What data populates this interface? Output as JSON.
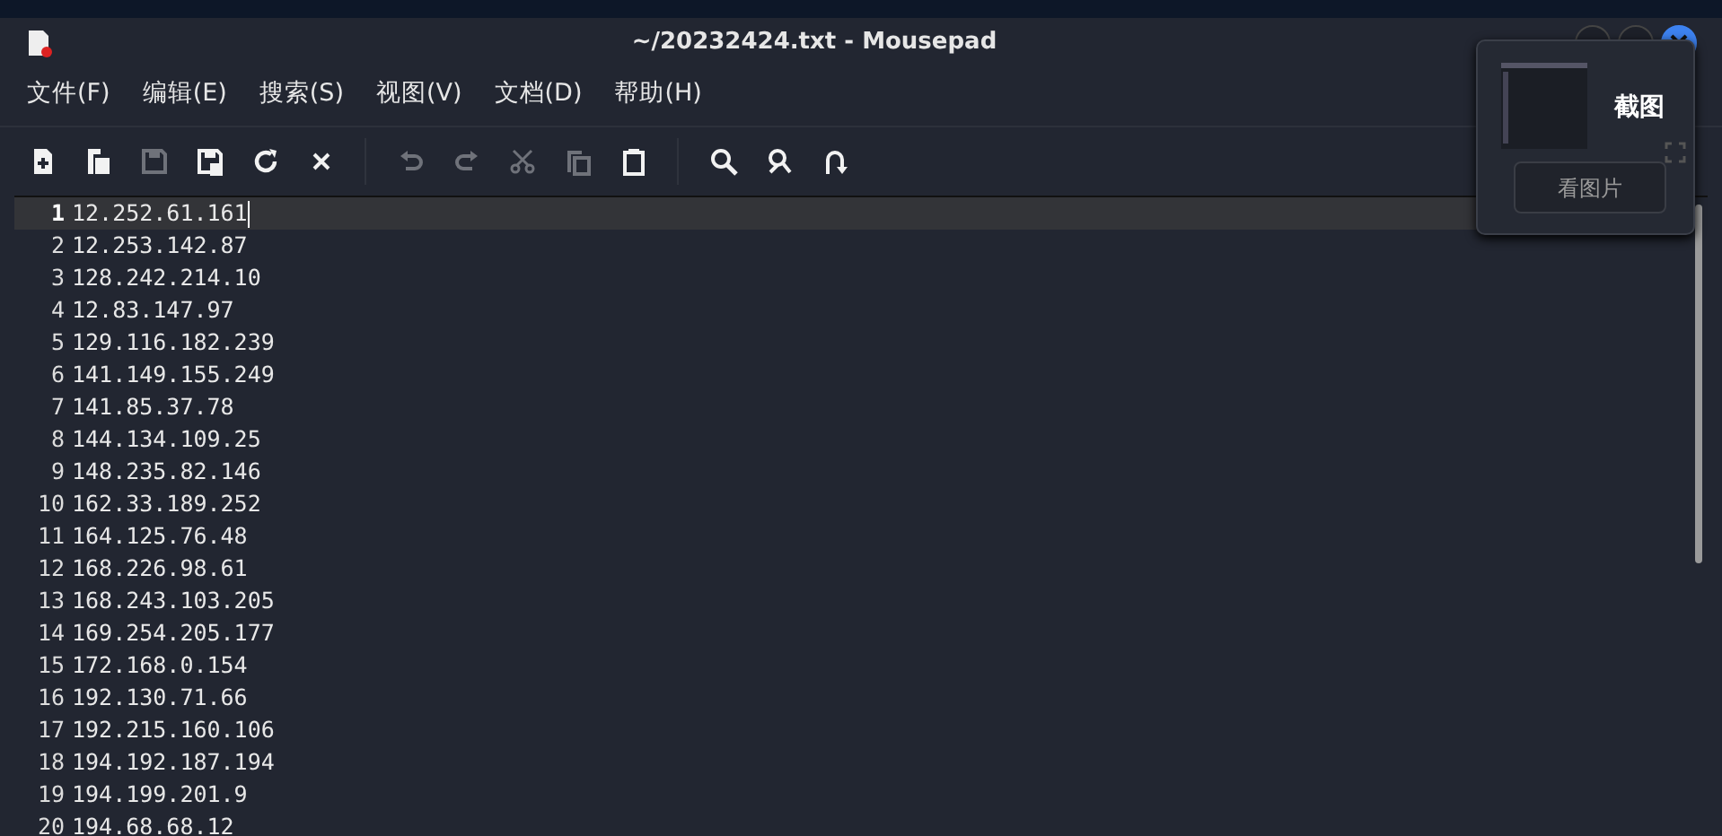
{
  "window": {
    "title": "~/20232424.txt - Mousepad"
  },
  "menu": [
    "文件(F)",
    "编辑(E)",
    "搜索(S)",
    "视图(V)",
    "文档(D)",
    "帮助(H)"
  ],
  "toolbar": [
    {
      "kind": "new",
      "disabled": false
    },
    {
      "kind": "open",
      "disabled": false
    },
    {
      "kind": "save",
      "disabled": true
    },
    {
      "kind": "saveas",
      "disabled": false
    },
    {
      "kind": "reload",
      "disabled": false
    },
    {
      "kind": "close",
      "disabled": false
    },
    {
      "kind": "sep"
    },
    {
      "kind": "undo",
      "disabled": true
    },
    {
      "kind": "redo",
      "disabled": true
    },
    {
      "kind": "cut",
      "disabled": true
    },
    {
      "kind": "copy",
      "disabled": true
    },
    {
      "kind": "paste",
      "disabled": false
    },
    {
      "kind": "sep"
    },
    {
      "kind": "find",
      "disabled": false
    },
    {
      "kind": "replace",
      "disabled": false
    },
    {
      "kind": "goto",
      "disabled": false
    }
  ],
  "lines": [
    {
      "number": "1",
      "text": "12.252.61.161",
      "current": true
    },
    {
      "number": "2",
      "text": "12.253.142.87",
      "current": false
    },
    {
      "number": "3",
      "text": "128.242.214.10",
      "current": false
    },
    {
      "number": "4",
      "text": "12.83.147.97",
      "current": false
    },
    {
      "number": "5",
      "text": "129.116.182.239",
      "current": false
    },
    {
      "number": "6",
      "text": "141.149.155.249",
      "current": false
    },
    {
      "number": "7",
      "text": "141.85.37.78",
      "current": false
    },
    {
      "number": "8",
      "text": "144.134.109.25",
      "current": false
    },
    {
      "number": "9",
      "text": "148.235.82.146",
      "current": false
    },
    {
      "number": "10",
      "text": "162.33.189.252",
      "current": false
    },
    {
      "number": "11",
      "text": "164.125.76.48",
      "current": false
    },
    {
      "number": "12",
      "text": "168.226.98.61",
      "current": false
    },
    {
      "number": "13",
      "text": "168.243.103.205",
      "current": false
    },
    {
      "number": "14",
      "text": "169.254.205.177",
      "current": false
    },
    {
      "number": "15",
      "text": "172.168.0.154",
      "current": false
    },
    {
      "number": "16",
      "text": "192.130.71.66",
      "current": false
    },
    {
      "number": "17",
      "text": "192.215.160.106",
      "current": false
    },
    {
      "number": "18",
      "text": "194.192.187.194",
      "current": false
    },
    {
      "number": "19",
      "text": "194.199.201.9",
      "current": false
    },
    {
      "number": "20",
      "text": "194.68.68.12",
      "current": false
    }
  ],
  "screenshot_popup": {
    "title": "截图",
    "button": "看图片"
  }
}
